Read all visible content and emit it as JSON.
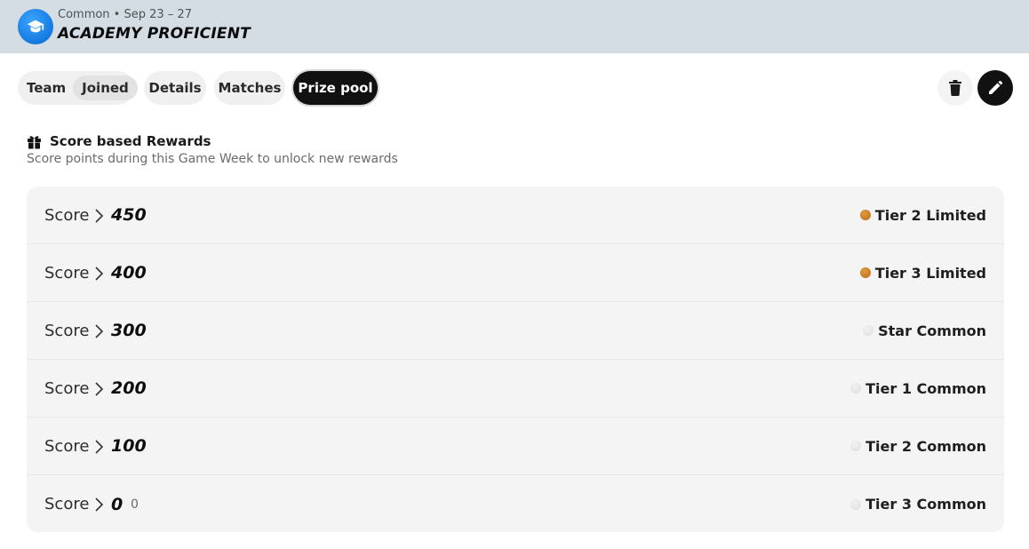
{
  "header": {
    "meta": "Common • Sep 23 – 27",
    "title": "ACADEMY PROFICIENT",
    "logo_icon": "graduation-cap-icon"
  },
  "tabs": {
    "team_label": "Team",
    "team_badge": "Joined",
    "details_label": "Details",
    "matches_label": "Matches",
    "prize_label": "Prize pool",
    "active": "Prize pool"
  },
  "actions": {
    "delete_icon": "trash-icon",
    "edit_icon": "pencil-icon"
  },
  "section": {
    "title": "Score based Rewards",
    "subtitle": "Score points during this Game Week to unlock new rewards",
    "icon": "gift-icon"
  },
  "rewards": [
    {
      "label": "Score",
      "value": "450",
      "extra": "",
      "reward": "Tier 2 Limited",
      "kind": "limited"
    },
    {
      "label": "Score",
      "value": "400",
      "extra": "",
      "reward": "Tier 3 Limited",
      "kind": "limited"
    },
    {
      "label": "Score",
      "value": "300",
      "extra": "",
      "reward": "Star Common",
      "kind": "common"
    },
    {
      "label": "Score",
      "value": "200",
      "extra": "",
      "reward": "Tier 1 Common",
      "kind": "common"
    },
    {
      "label": "Score",
      "value": "100",
      "extra": "",
      "reward": "Tier 2 Common",
      "kind": "common"
    },
    {
      "label": "Score",
      "value": "0",
      "extra": "0",
      "reward": "Tier 3 Common",
      "kind": "common"
    }
  ],
  "colors": {
    "header_bg": "#d3dde3",
    "active_tab": "#111111",
    "limited_dot": "#c27a26",
    "common_dot": "#e6e6e6"
  }
}
